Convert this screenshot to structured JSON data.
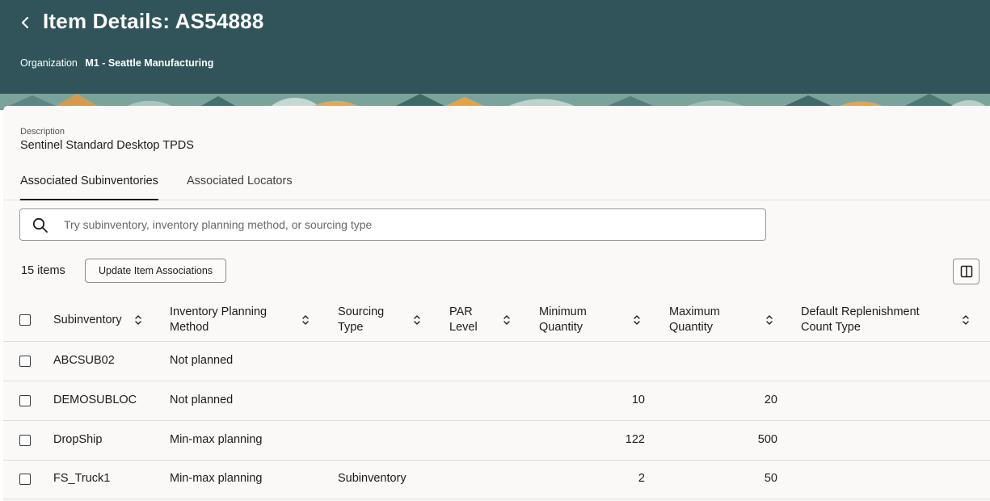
{
  "header": {
    "title": "Item Details: AS54888",
    "organization_label": "Organization",
    "organization_value": "M1 - Seattle Manufacturing",
    "background_color": "#30545a"
  },
  "description": {
    "label": "Description",
    "value": "Sentinel Standard Desktop TPDS"
  },
  "tabs": [
    {
      "label": "Associated Subinventories",
      "active": true
    },
    {
      "label": "Associated Locators",
      "active": false
    }
  ],
  "search": {
    "placeholder": "Try subinventory, inventory planning method, or sourcing type",
    "value": ""
  },
  "toolbar": {
    "count": "15 items",
    "update_label": "Update Item Associations"
  },
  "table": {
    "columns": [
      {
        "line1": "Subinventory",
        "line2": ""
      },
      {
        "line1": "Inventory Planning",
        "line2": "Method"
      },
      {
        "line1": "Sourcing",
        "line2": "Type"
      },
      {
        "line1": "PAR",
        "line2": "Level"
      },
      {
        "line1": "Minimum",
        "line2": "Quantity"
      },
      {
        "line1": "Maximum",
        "line2": "Quantity"
      },
      {
        "line1": "Default Replenishment",
        "line2": "Count Type"
      }
    ],
    "rows": [
      {
        "subinventory": "ABCSUB02",
        "method": "Not planned",
        "sourcing": "",
        "par": "",
        "min": "",
        "max": "",
        "count_type": ""
      },
      {
        "subinventory": "DEMOSUBLOC",
        "method": "Not planned",
        "sourcing": "",
        "par": "",
        "min": "10",
        "max": "20",
        "count_type": ""
      },
      {
        "subinventory": "DropShip",
        "method": "Min-max planning",
        "sourcing": "",
        "par": "",
        "min": "122",
        "max": "500",
        "count_type": ""
      },
      {
        "subinventory": "FS_Truck1",
        "method": "Min-max planning",
        "sourcing": "Subinventory",
        "par": "",
        "min": "2",
        "max": "50",
        "count_type": ""
      }
    ]
  }
}
